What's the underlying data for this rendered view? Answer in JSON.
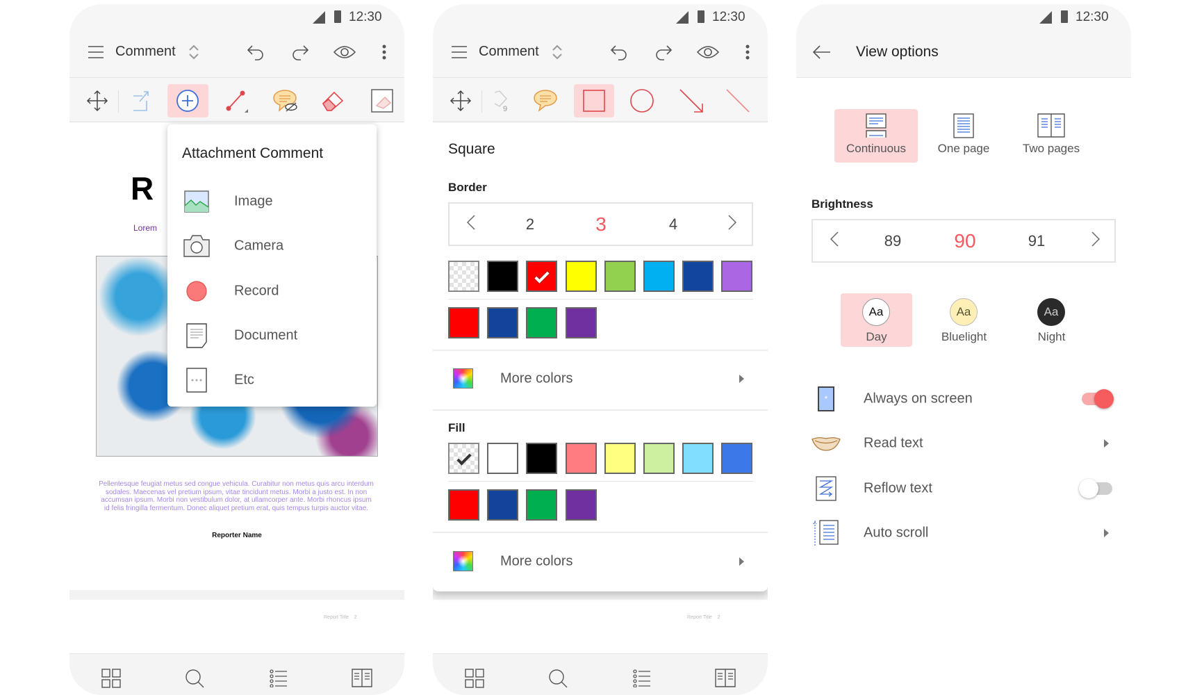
{
  "status": {
    "time": "12:30"
  },
  "editor_attachment": {
    "mode_title": "Comment",
    "document": {
      "title_fragment": "R",
      "subtitle_fragment": "Lorem",
      "paragraph": "Pellentesque feugiat metus sed congue vehicula. Curabitur non metus quis arcu interdum sodales. Maecenas vel pretium ipsum, vitae tincidunt metus. Morbi a justo est. In non accumsan ipsum. Morbi non vestibulum dolor, at ullamcorper ante. Morbi rhoncus ipsum id felis fringilla fermentum. Donec aliquet pretium erat, quis tempus turpis auctor vitae.",
      "reporter": "Reporter Name",
      "footer_title": "Report Title",
      "footer_page": "2"
    },
    "menu": {
      "title": "Attachment Comment",
      "items": [
        {
          "label": "Image",
          "icon": "image-icon"
        },
        {
          "label": "Camera",
          "icon": "camera-icon"
        },
        {
          "label": "Record",
          "icon": "record-icon"
        },
        {
          "label": "Document",
          "icon": "document-icon"
        },
        {
          "label": "Etc",
          "icon": "more-icon"
        }
      ]
    },
    "active_tool": "attachment-comment"
  },
  "editor_square": {
    "mode_title": "Comment",
    "tool_badge": "9",
    "panel_title": "Square",
    "border": {
      "label": "Border",
      "values": [
        "2",
        "3",
        "4"
      ],
      "selected": "3",
      "colors_row1": [
        "transparent",
        "#000000",
        "#ff0000",
        "#ffff00",
        "#92d050",
        "#00b0f0",
        "#12459e",
        "#ab66e3"
      ],
      "colors_row2": [
        "#ff0000",
        "#12449c",
        "#00b050",
        "#7030a0"
      ],
      "selected_color": "#ff0000",
      "more_colors": "More colors"
    },
    "fill": {
      "label": "Fill",
      "colors_row1": [
        "transparent",
        "#ffffff",
        "#000000",
        "#ff7c80",
        "#ffff80",
        "#ccf0a0",
        "#80dfff",
        "#3c78e8"
      ],
      "colors_row2": [
        "#ff0000",
        "#12449c",
        "#00b050",
        "#7030a0"
      ],
      "selected_color": "transparent",
      "more_colors": "More colors"
    },
    "footer_title": "Report Title",
    "footer_page": "2"
  },
  "view_options": {
    "title": "View options",
    "layouts": [
      {
        "label": "Continuous",
        "selected": true
      },
      {
        "label": "One page",
        "selected": false
      },
      {
        "label": "Two pages",
        "selected": false
      }
    ],
    "brightness": {
      "label": "Brightness",
      "values": [
        "89",
        "90",
        "91"
      ],
      "selected": "90"
    },
    "themes": [
      {
        "label": "Day",
        "sample": "Aa",
        "selected": true
      },
      {
        "label": "Bluelight",
        "sample": "Aa",
        "selected": false
      },
      {
        "label": "Night",
        "sample": "Aa",
        "selected": false
      }
    ],
    "settings": [
      {
        "label": "Always on screen",
        "control": "toggle",
        "on": true
      },
      {
        "label": "Read text",
        "control": "arrow"
      },
      {
        "label": "Reflow text",
        "control": "toggle",
        "on": false
      },
      {
        "label": "Auto scroll",
        "control": "arrow"
      }
    ]
  },
  "colors": {
    "accent": "#f2585e",
    "highlight": "#fdd6d8"
  }
}
